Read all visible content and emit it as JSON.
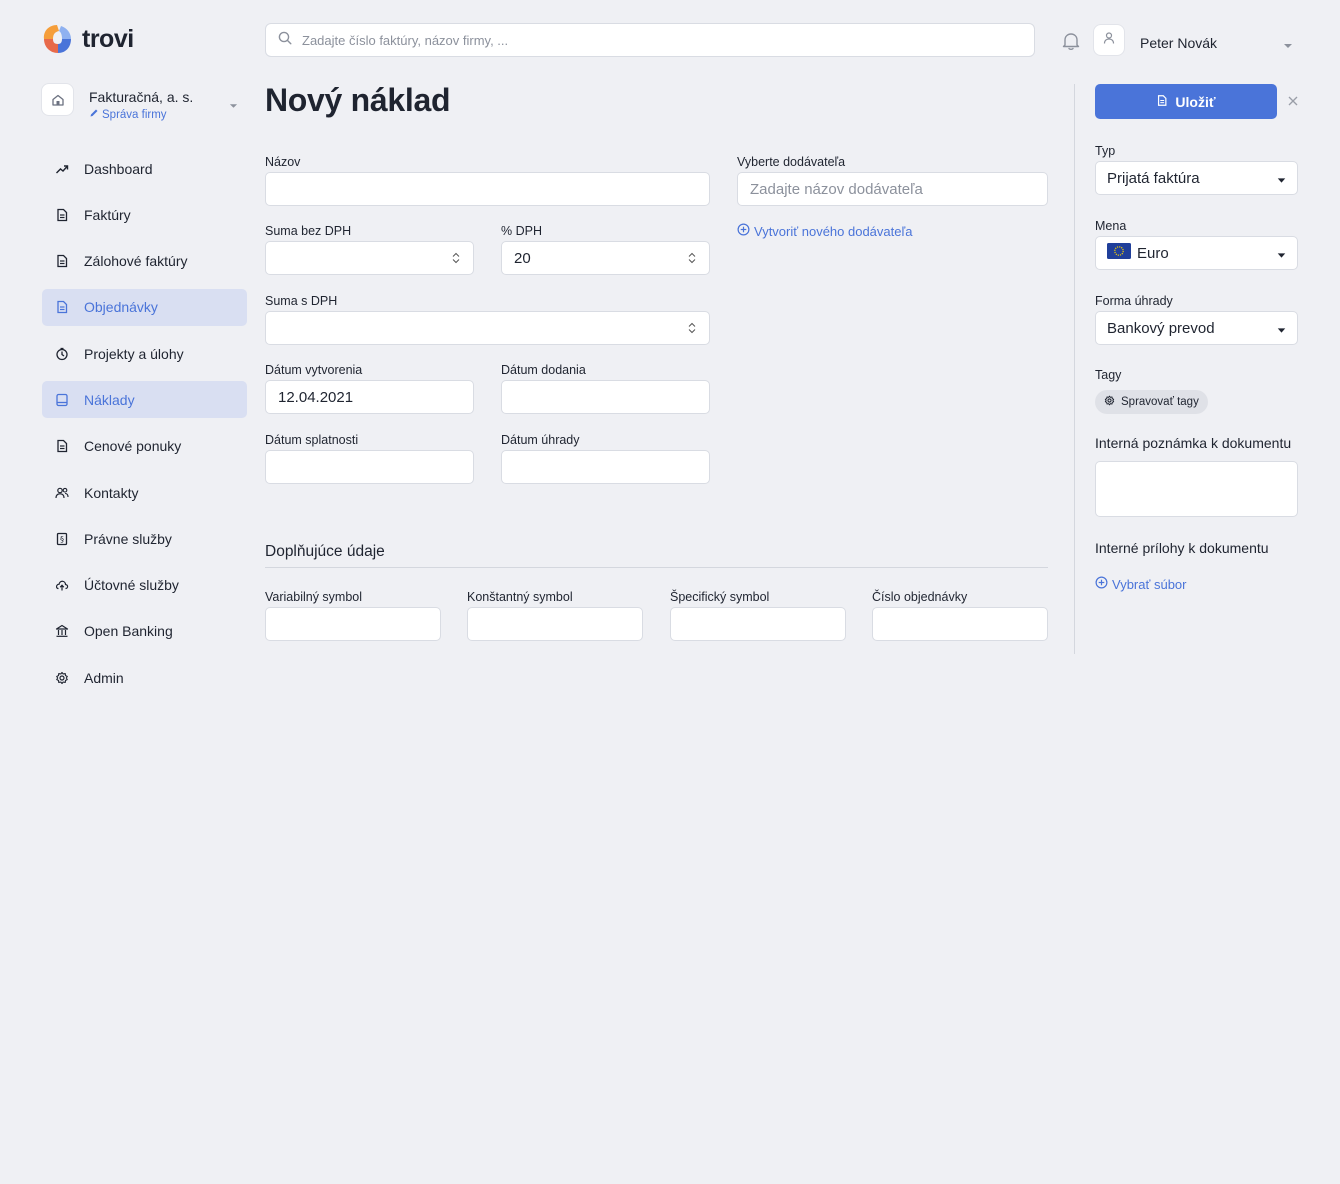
{
  "brand": {
    "name": "trovi"
  },
  "search": {
    "placeholder": "Zadajte číslo faktúry, názov firmy, ..."
  },
  "user": {
    "name": "Peter Novák"
  },
  "company": {
    "name": "Fakturačná, a. s.",
    "manage_label": "Správa firmy"
  },
  "sidebar": {
    "items": [
      {
        "label": "Dashboard",
        "icon": "trend-icon",
        "active": false
      },
      {
        "label": "Faktúry",
        "icon": "document-icon",
        "active": false
      },
      {
        "label": "Zálohové faktúry",
        "icon": "document-icon",
        "active": false
      },
      {
        "label": "Objednávky",
        "icon": "document-icon",
        "active": true
      },
      {
        "label": "Projekty a úlohy",
        "icon": "timer-icon",
        "active": false
      },
      {
        "label": "Náklady",
        "icon": "tray-icon",
        "active": true
      },
      {
        "label": "Cenové ponuky",
        "icon": "document-icon",
        "active": false
      },
      {
        "label": "Kontakty",
        "icon": "people-icon",
        "active": false
      },
      {
        "label": "Právne služby",
        "icon": "legal-icon",
        "active": false
      },
      {
        "label": "Účtovné služby",
        "icon": "upload-cloud-icon",
        "active": false
      },
      {
        "label": "Open Banking",
        "icon": "bank-icon",
        "active": false
      },
      {
        "label": "Admin",
        "icon": "gear-icon",
        "active": false
      }
    ]
  },
  "page": {
    "title": "Nový náklad"
  },
  "form": {
    "name_label": "Názov",
    "name_value": "",
    "amount_net_label": "Suma bez DPH",
    "amount_net_value": "",
    "vat_label": "% DPH",
    "vat_value": "20",
    "amount_gross_label": "Suma s DPH",
    "amount_gross_value": "",
    "created_label": "Dátum vytvorenia",
    "created_value": "12.04.2021",
    "delivery_label": "Dátum dodania",
    "delivery_value": "",
    "due_label": "Dátum splatnosti",
    "due_value": "",
    "paid_label": "Dátum úhrady",
    "paid_value": "",
    "supplier_label": "Vyberte dodávateľa",
    "supplier_placeholder": "Zadajte názov dodávateľa",
    "create_supplier_label": "Vytvoriť nového dodávateľa"
  },
  "extra": {
    "title": "Doplňujúce údaje",
    "variable_symbol_label": "Variabilný symbol",
    "constant_symbol_label": "Konštantný symbol",
    "specific_symbol_label": "Špecifický symbol",
    "order_number_label": "Číslo objednávky"
  },
  "panel": {
    "save_label": "Uložiť",
    "type_label": "Typ",
    "type_value": "Prijatá faktúra",
    "currency_label": "Mena",
    "currency_value": "Euro",
    "payment_label": "Forma úhrady",
    "payment_value": "Bankový prevod",
    "tags_label": "Tagy",
    "manage_tags_label": "Spravovať tagy",
    "note_label": "Interná poznámka k dokumentu",
    "attachments_label": "Interné prílohy k dokumentu",
    "choose_file_label": "Vybrať súbor"
  },
  "colors": {
    "accent": "#4a74d9",
    "active_bg": "#d9dff2",
    "background": "#eff0f4"
  }
}
